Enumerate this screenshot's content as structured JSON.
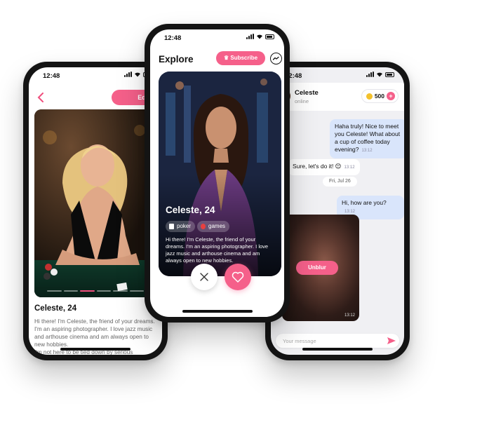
{
  "left_phone": {
    "status_time": "12:48",
    "back_icon": "chevron-left-icon",
    "edit_label": "Edit Profile",
    "profile_name": "Celeste, 24",
    "bio": "Hi there! I'm Celeste, the friend of your dreams. I'm an aspiring photographer. I love jazz music and arthouse cinema and am always open to new hobbies.",
    "bio_more": "I'm not here to be tied down by serious relationships, so I take things one day at",
    "photo_count": 6,
    "active_photo_index": 2
  },
  "mid_phone": {
    "status_time": "12:48",
    "title": "Explore",
    "subscribe_label": "Subscribe",
    "card_name": "Celeste, 24",
    "tags": [
      {
        "label": "poker",
        "icon": "poker-icon"
      },
      {
        "label": "games",
        "icon": "games-icon"
      }
    ],
    "card_bio": "Hi there! I'm Celeste, the friend of your dreams. I'm an aspiring photographer. I love jazz music and arthouse cinema and am always open to new hobbies.",
    "accent": "#f5608a"
  },
  "right_phone": {
    "status_time": "12:48",
    "contact_name": "Celeste",
    "contact_status": "online",
    "coins": "500",
    "messages": [
      {
        "side": "out",
        "text": "Haha truly! Nice to meet you Celeste! What about a cup of coffee today evening?",
        "time": "13:12"
      },
      {
        "side": "in",
        "text": "Sure, let's do it! 😊",
        "time": "13:12"
      },
      {
        "side": "out",
        "text": "Hi, how are you?",
        "time": "13:12"
      }
    ],
    "date_separator": "Fri, Jul 26",
    "unblur_label": "Unblur",
    "photo_time": "13:12",
    "composer_placeholder": "Your message"
  }
}
